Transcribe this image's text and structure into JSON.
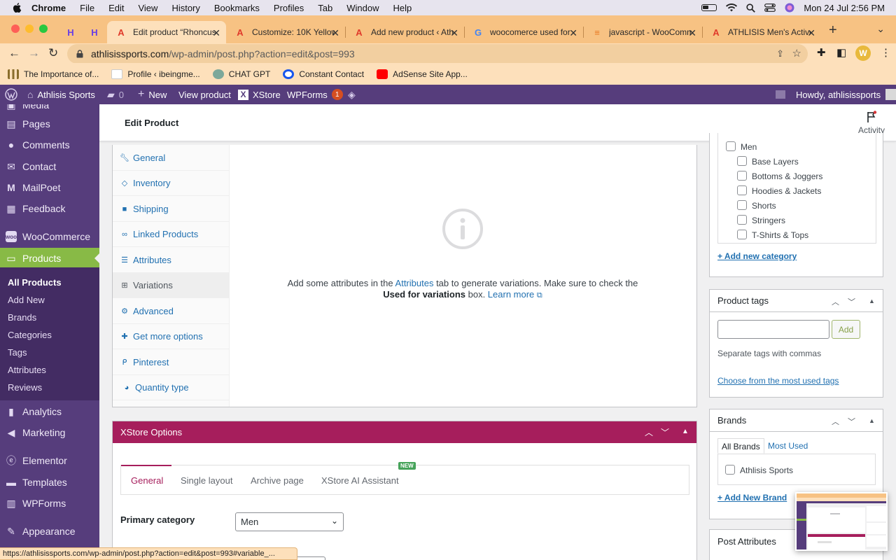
{
  "macbar": {
    "app": "Chrome",
    "menus": [
      "File",
      "Edit",
      "View",
      "History",
      "Bookmarks",
      "Profiles",
      "Tab",
      "Window",
      "Help"
    ],
    "datetime": "Mon 24 Jul  2:56 PM"
  },
  "tabs": [
    {
      "title": "Edit product “Rhoncus",
      "active": true
    },
    {
      "title": "Customize: 10K Yellow"
    },
    {
      "title": "Add new product ‹ Ath"
    },
    {
      "title": "woocomerce used for"
    },
    {
      "title": "javascript - WooComm"
    },
    {
      "title": "ATHLISIS Men's Active"
    }
  ],
  "address": {
    "host": "athlisissports.com",
    "path": "/wp-admin/post.php?action=edit&post=993"
  },
  "bookmarks": [
    "The Importance of...",
    "Profile ‹ ibeingme...",
    "CHAT GPT",
    "Constant Contact",
    "AdSense Site App..."
  ],
  "adminbar": {
    "site": "Athlisis Sports",
    "comments": "0",
    "new": "New",
    "view": "View product",
    "xstore": "XStore",
    "wpforms": "WPForms",
    "wpforms_badge": "1",
    "howdy": "Howdy, athlisissports"
  },
  "sidebar": {
    "items": [
      {
        "label": "Media",
        "icon": "media-icon"
      },
      {
        "label": "Pages",
        "icon": "pages-icon"
      },
      {
        "label": "Comments",
        "icon": "comments-icon"
      },
      {
        "label": "Contact",
        "icon": "envelope-icon"
      },
      {
        "label": "MailPoet",
        "icon": "mailpoet-icon"
      },
      {
        "label": "Feedback",
        "icon": "feedback-icon"
      },
      {
        "label": "WooCommerce",
        "icon": "woo-icon"
      },
      {
        "label": "Products",
        "icon": "archive-icon",
        "current": true
      },
      {
        "label": "Analytics",
        "icon": "bar-chart-icon"
      },
      {
        "label": "Marketing",
        "icon": "megaphone-icon"
      },
      {
        "label": "Elementor",
        "icon": "elementor-icon"
      },
      {
        "label": "Templates",
        "icon": "folder-icon"
      },
      {
        "label": "WPForms",
        "icon": "forms-icon"
      },
      {
        "label": "Appearance",
        "icon": "brush-icon"
      }
    ],
    "submenu": [
      "All Products",
      "Add New",
      "Brands",
      "Categories",
      "Tags",
      "Attributes",
      "Reviews"
    ]
  },
  "page": {
    "title": "Edit Product",
    "activity": "Activity"
  },
  "product_data": {
    "tabs": [
      "General",
      "Inventory",
      "Shipping",
      "Linked Products",
      "Attributes",
      "Variations",
      "Advanced",
      "Get more options",
      "Pinterest",
      "Quantity type"
    ],
    "active_tab": "Variations",
    "msg_part1": "Add some attributes in the ",
    "msg_link": "Attributes",
    "msg_part2": " tab to generate variations. Make sure to check the ",
    "msg_bold": "Used for variations",
    "msg_part3": " box. ",
    "msg_learn": "Learn more"
  },
  "xstore": {
    "title": "XStore Options",
    "tabs": [
      "General",
      "Single layout",
      "Archive page",
      "XStore AI Assistant"
    ],
    "new_badge": "NEW",
    "primary_category_label": "Primary category",
    "primary_category_value": "Men"
  },
  "categories": {
    "parent": "Men",
    "children": [
      "Base Layers",
      "Bottoms & Joggers",
      "Hoodies & Jackets",
      "Shorts",
      "Stringers",
      "T-Shirts & Tops"
    ],
    "add_new": "+ Add new category"
  },
  "tags": {
    "title": "Product tags",
    "add": "Add",
    "hint": "Separate tags with commas",
    "choose": "Choose from the most used tags"
  },
  "brands": {
    "title": "Brands",
    "tab_all": "All Brands",
    "tab_most": "Most Used",
    "item": "Athlisis Sports",
    "add_new": "+ Add New Brand"
  },
  "post_attributes": {
    "title": "Post Attributes"
  },
  "statusbar": "https://athlisissports.com/wp-admin/post.php?action=edit&post=993#variable_..."
}
